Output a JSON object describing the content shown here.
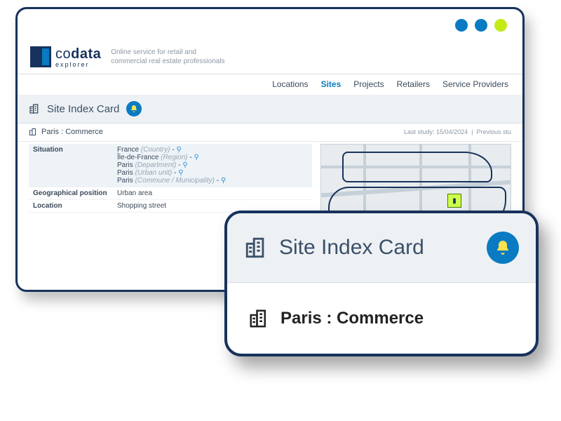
{
  "logo": {
    "brand_a": "co",
    "brand_b": "data",
    "sub": "explorer"
  },
  "tagline_l1": "Online service for retail and",
  "tagline_l2": "commercial real estate professionals",
  "nav": {
    "locations": "Locations",
    "sites": "Sites",
    "projects": "Projects",
    "retailers": "Retailers",
    "providers": "Service Providers"
  },
  "title": "Site Index Card",
  "crumb": "Paris : Commerce",
  "crumb_meta_label": "Last study:",
  "crumb_meta_date": "15/04/2024",
  "crumb_meta_sep": "|",
  "crumb_meta_tail": "Previous stu",
  "rows": {
    "situation_label": "Situation",
    "s0_name": "France",
    "s0_type": " (Country)",
    "s1_name": "Île-de-France",
    "s1_type": " (Region)",
    "s2_name": "Paris",
    "s2_type": " (Department)",
    "s3_name": "Paris",
    "s3_type": " (Urban unit)",
    "s4_name": "Paris",
    "s4_type": " (Commune / Municipality)",
    "geo_label": "Geographical position",
    "geo_val": "Urban area",
    "loc_label": "Location",
    "loc_val": "Shopping street"
  },
  "overlay": {
    "title": "Site Index Card",
    "name": "Paris : Commerce"
  }
}
